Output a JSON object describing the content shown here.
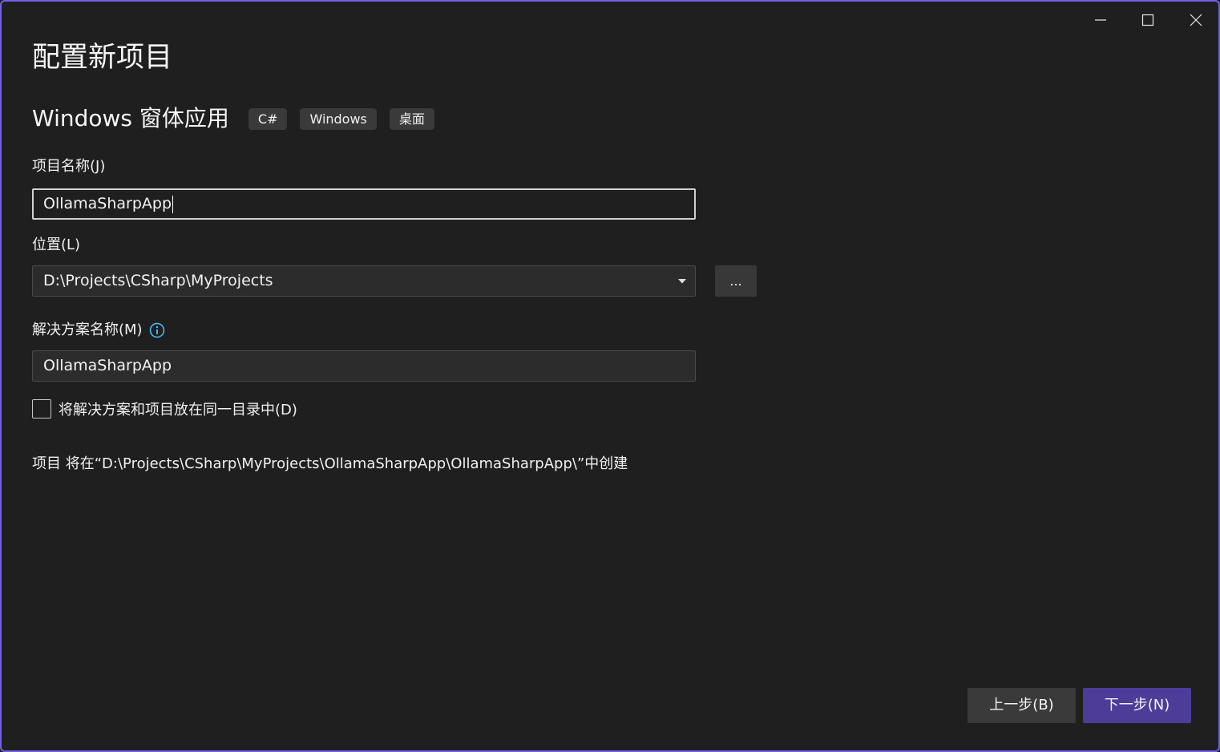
{
  "window": {
    "accent_color": "#7160e8",
    "controls": {
      "minimize_icon": "minimize-icon",
      "maximize_icon": "maximize-icon",
      "close_icon": "close-icon"
    }
  },
  "page": {
    "title": "配置新项目",
    "template_name": "Windows 窗体应用",
    "tags": [
      "C#",
      "Windows",
      "桌面"
    ]
  },
  "form": {
    "project_name": {
      "label": "项目名称(J)",
      "value": "OllamaSharpApp"
    },
    "location": {
      "label": "位置(L)",
      "value": "D:\\Projects\\CSharp\\MyProjects",
      "browse_label": "..."
    },
    "solution_name": {
      "label": "解决方案名称(M)",
      "value": "OllamaSharpApp",
      "info_icon": "info-icon"
    },
    "same_directory": {
      "label": "将解决方案和项目放在同一目录中(D)",
      "checked": false
    },
    "path_note": "项目 将在“D:\\Projects\\CSharp\\MyProjects\\OllamaSharpApp\\OllamaSharpApp\\”中创建"
  },
  "footer": {
    "back_label": "上一步(B)",
    "next_label": "下一步(N)",
    "next_color": "#4d3d99"
  }
}
